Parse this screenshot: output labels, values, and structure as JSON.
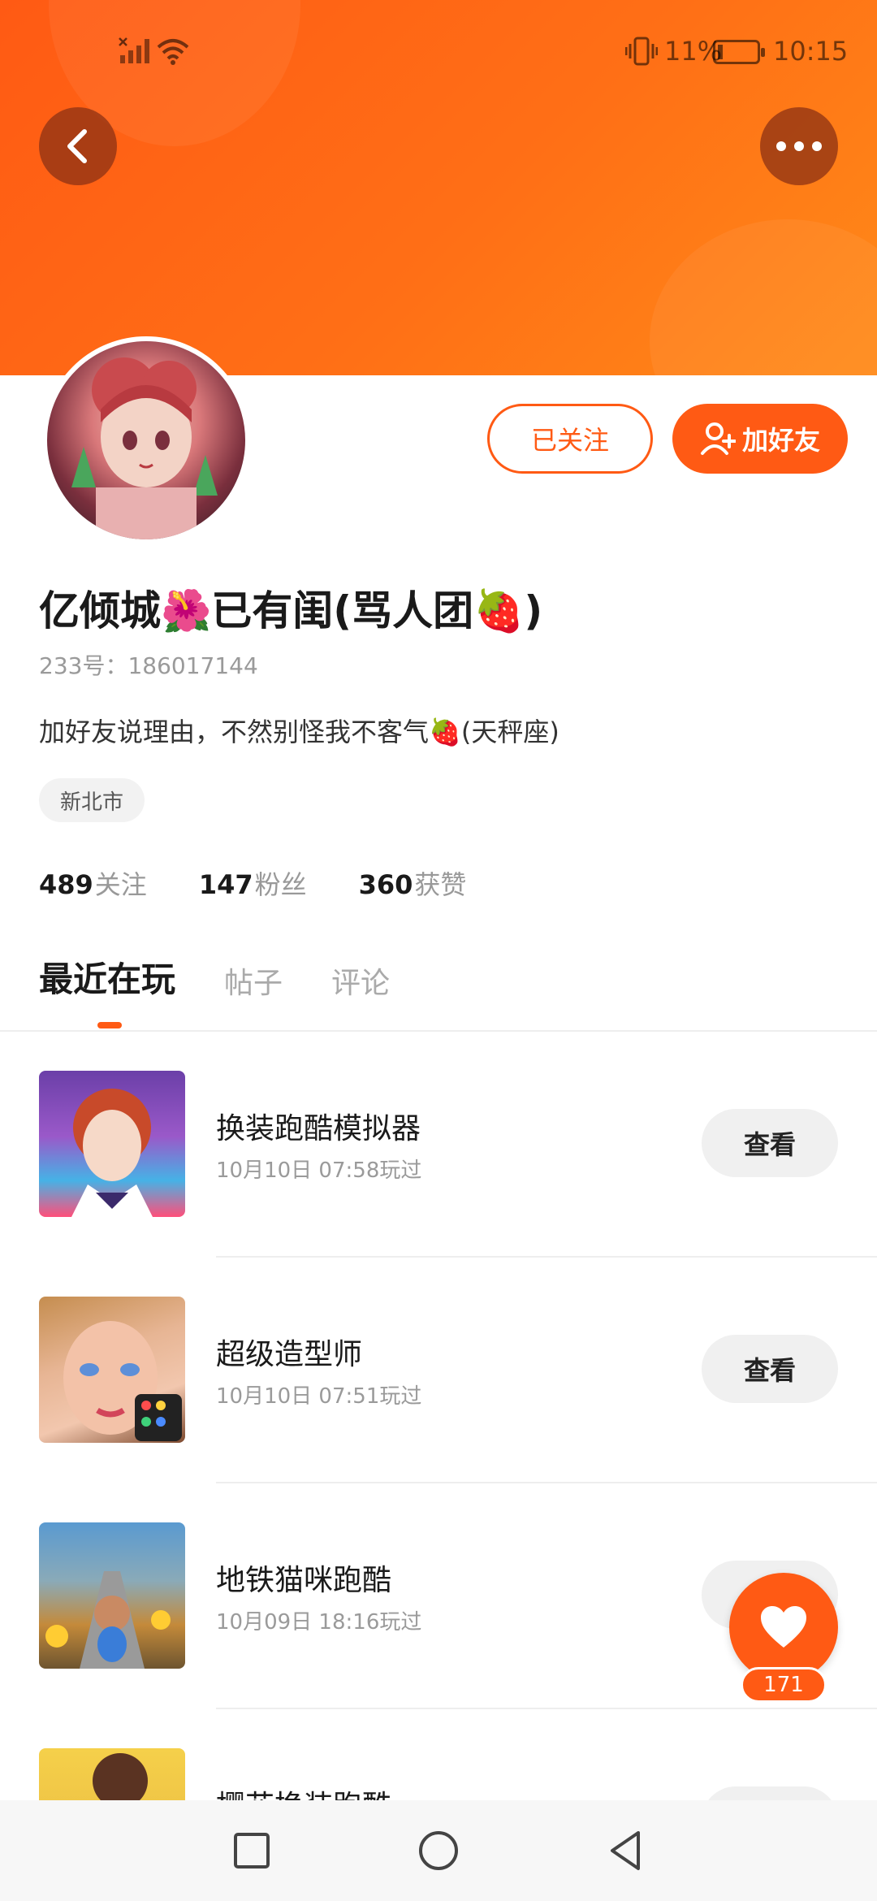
{
  "status_bar": {
    "battery_pct": "11%",
    "battery_level": 0.11,
    "time": "10:15"
  },
  "colors": {
    "accent": "#ff5a14",
    "banner": "#ff6f16"
  },
  "header": {
    "back_icon": "chevron-left-icon",
    "more_icon": "more-horizontal-icon"
  },
  "profile": {
    "nickname": "亿倾城🌺已有闺(骂人团🍓)",
    "uid": "233号：186017144",
    "bio": "加好友说理由，不然别怪我不客气🍓(天秤座)",
    "location": "新北市",
    "follow_button": "已关注",
    "add_friend_button": "加好友"
  },
  "stats": [
    {
      "value": "489",
      "label": "关注"
    },
    {
      "value": "147",
      "label": "粉丝"
    },
    {
      "value": "360",
      "label": "获赞"
    }
  ],
  "tabs": [
    "最近在玩",
    "帖子",
    "评论"
  ],
  "games": [
    {
      "name": "换装跑酷模拟器",
      "played": "10月10日 07:58玩过",
      "button": "查看"
    },
    {
      "name": "超级造型师",
      "played": "10月10日 07:51玩过",
      "button": "查看"
    },
    {
      "name": "地铁猫咪跑酷",
      "played": "10月09日 18:16玩过",
      "button": ""
    },
    {
      "name": "樱花换装跑酷",
      "played": "",
      "button": ""
    }
  ],
  "like": {
    "count": "171"
  }
}
